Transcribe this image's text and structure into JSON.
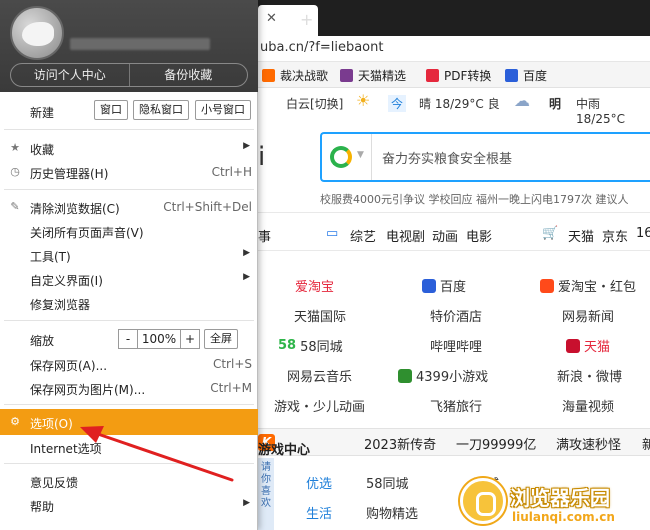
{
  "browser": {
    "address": "uba.cn/?f=liebaont",
    "bookmarks": [
      "裁决战歌",
      "天猫精选",
      "PDF转换",
      "百度"
    ],
    "weather": {
      "location": "白云[切换]",
      "today_label": "今",
      "today_text": "晴 18/29°C 良",
      "tomorrow_label": "明",
      "tomorrow_text": "中雨 18/25°C"
    },
    "search_placeholder": "奋力夯实粮食安全根基",
    "hot_searches": "校服费4000元引争议 学校回应   福州一晚上闪电1797次   建议人",
    "big_char": "i",
    "categories": [
      "事",
      "综艺",
      "电视剧",
      "动画",
      "电影",
      "天猫",
      "京东",
      "16"
    ],
    "sites": [
      [
        "爱淘宝",
        "百度",
        "爱淘宝・红包"
      ],
      [
        "天猫国际",
        "特价酒店",
        "网易新闻"
      ],
      [
        "58同城",
        "哔哩哔哩",
        "天猫"
      ],
      [
        "网易云音乐",
        "4399小游戏",
        "新浪・微博"
      ],
      [
        "游戏・少儿动画",
        "飞猪旅行",
        "海量视频"
      ]
    ],
    "game_center": "游戏中心",
    "game_items": [
      "2023新传奇",
      "一刀99999亿",
      "满攻速秒怪",
      "新"
    ],
    "bottom_rows": [
      [
        "优选",
        "58同城",
        "同城"
      ],
      [
        "生活",
        "购物精选",
        "品"
      ]
    ],
    "side_strip": "请 你 喜 欢",
    "watermark_title": "浏览器乐园",
    "watermark_url": "liulanqi.com.cn"
  },
  "menu": {
    "header_buttons": [
      "访问个人中心",
      "备份收藏"
    ],
    "new_label": "新建",
    "new_buttons": [
      "窗口",
      "隐私窗口",
      "小号窗口"
    ],
    "items": [
      {
        "label": "收藏",
        "arrow": true
      },
      {
        "label": "历史管理器(H)",
        "shortcut": "Ctrl+H"
      },
      {
        "label": "清除浏览数据(C)",
        "shortcut": "Ctrl+Shift+Del"
      },
      {
        "label": "关闭所有页面声音(V)"
      },
      {
        "label": "工具(T)",
        "arrow": true
      },
      {
        "label": "自定义界面(I)",
        "arrow": true
      },
      {
        "label": "修复浏览器"
      },
      {
        "label": "缩放"
      },
      {
        "label": "保存网页(A)...",
        "shortcut": "Ctrl+S"
      },
      {
        "label": "保存网页为图片(M)...",
        "shortcut": "Ctrl+M"
      },
      {
        "label": "选项(O)"
      },
      {
        "label": "Internet选项"
      },
      {
        "label": "意见反馈"
      },
      {
        "label": "帮助",
        "arrow": true
      }
    ],
    "zoom": {
      "minus": "-",
      "value": "100%",
      "plus": "+",
      "fullscreen": "全屏"
    }
  }
}
